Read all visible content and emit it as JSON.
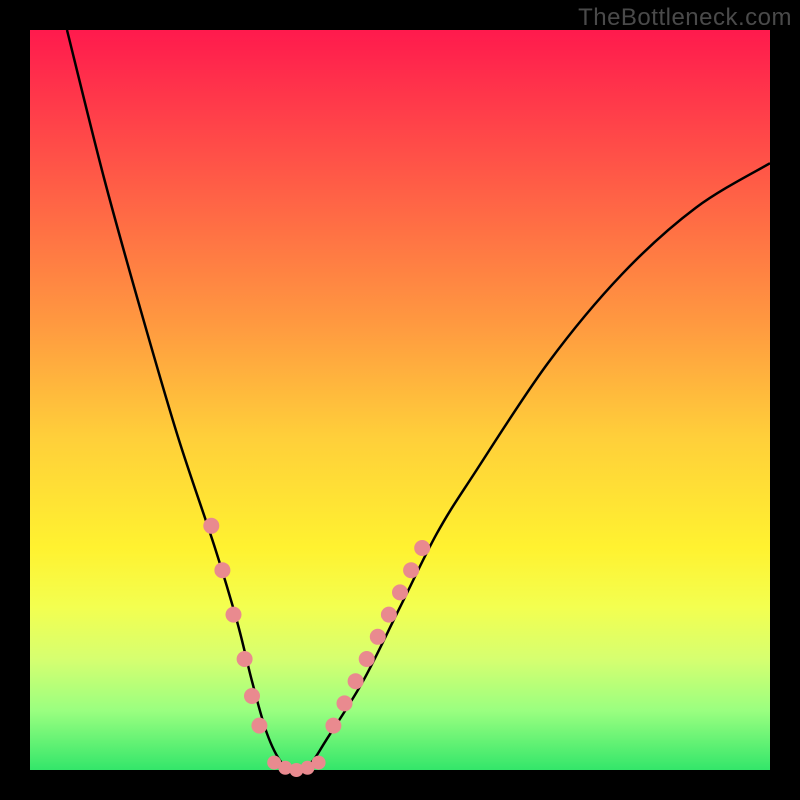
{
  "watermark": "TheBottleneck.com",
  "chart_data": {
    "type": "line",
    "title": "",
    "xlabel": "",
    "ylabel": "",
    "xlim": [
      0,
      100
    ],
    "ylim": [
      0,
      100
    ],
    "gradient_stops": [
      {
        "pos": 0,
        "color": "#ff1a4d"
      },
      {
        "pos": 25,
        "color": "#ff6a45"
      },
      {
        "pos": 55,
        "color": "#ffcf3a"
      },
      {
        "pos": 78,
        "color": "#f3ff50"
      },
      {
        "pos": 100,
        "color": "#33e66a"
      }
    ],
    "series": [
      {
        "name": "bottleneck-curve",
        "x": [
          5,
          10,
          15,
          20,
          25,
          28,
          30,
          32,
          34,
          36,
          38,
          40,
          45,
          50,
          55,
          60,
          70,
          80,
          90,
          100
        ],
        "y": [
          100,
          80,
          62,
          45,
          30,
          20,
          12,
          5,
          1,
          0,
          1,
          4,
          12,
          22,
          32,
          40,
          55,
          67,
          76,
          82
        ]
      }
    ],
    "markers": [
      {
        "name": "left-cluster",
        "x": [
          24.5,
          26,
          27.5,
          29,
          30,
          31
        ],
        "y": [
          33,
          27,
          21,
          15,
          10,
          6
        ]
      },
      {
        "name": "right-cluster",
        "x": [
          41,
          42.5,
          44,
          45.5,
          47,
          48.5,
          50,
          51.5,
          53
        ],
        "y": [
          6,
          9,
          12,
          15,
          18,
          21,
          24,
          27,
          30
        ]
      },
      {
        "name": "valley-floor",
        "x": [
          33,
          34.5,
          36,
          37.5,
          39
        ],
        "y": [
          1,
          0.3,
          0,
          0.3,
          1
        ]
      }
    ],
    "marker_color": "#e98a8f",
    "curve_color": "#000000"
  }
}
